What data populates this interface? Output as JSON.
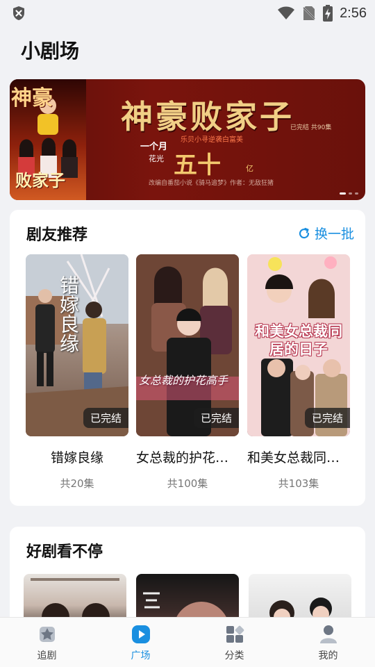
{
  "status_bar": {
    "time": "2:56",
    "icons": [
      "shield-x-icon",
      "wifi-icon",
      "no-sim-icon",
      "battery-charging-icon"
    ]
  },
  "page": {
    "title": "小剧场"
  },
  "banner": {
    "title": "神豪败家子",
    "poster_text_top": "神豪",
    "poster_text_bottom": "败家子",
    "status": "已完结 共90集",
    "subtitle": "乐贝小寻逆袭白富美",
    "line1": "一个月",
    "line2": "花光",
    "big": "五十",
    "unit": "亿",
    "credit": "改编自番茄小说《骑马追梦》作者：无敌狂猪",
    "page_count": 3,
    "active_page": 0
  },
  "recommend": {
    "title": "剧友推荐",
    "refresh_label": "换一批",
    "items": [
      {
        "name": "错嫁良缘",
        "episodes": "共20集",
        "tag": "已完结",
        "poster_text": "错嫁良缘"
      },
      {
        "name": "女总裁的护花高...",
        "episodes": "共100集",
        "tag": "已完结",
        "poster_text": "女总裁的护花高手"
      },
      {
        "name": "和美女总裁同居...",
        "episodes": "共103集",
        "tag": "已完结",
        "poster_text": "和美女总裁同居的日子"
      }
    ]
  },
  "binge": {
    "title": "好剧看不停"
  },
  "bottom_nav": {
    "items": [
      {
        "label": "追剧",
        "icon": "star-icon"
      },
      {
        "label": "广场",
        "icon": "play-icon",
        "active": true
      },
      {
        "label": "分类",
        "icon": "category-icon"
      },
      {
        "label": "我的",
        "icon": "person-icon"
      }
    ],
    "accent": "#1a8fe0"
  }
}
